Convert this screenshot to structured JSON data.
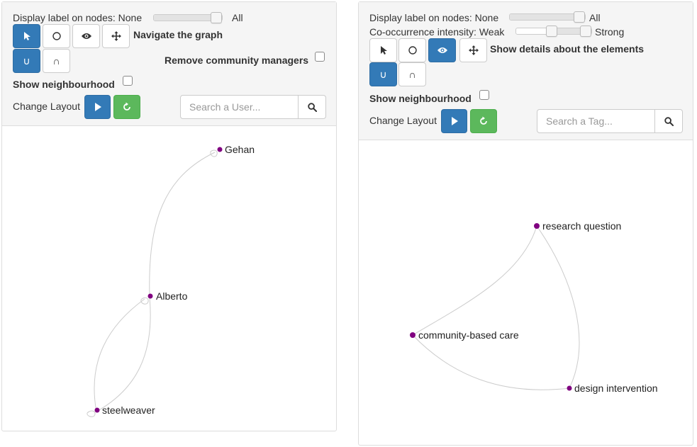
{
  "left_panel": {
    "label_slider": {
      "label": "Display label on nodes: None",
      "end_label": "All",
      "value": 1.0
    },
    "mode_description": "Navigate the graph",
    "remove_community_managers_label": "Remove community managers",
    "show_neighbourhood_label": "Show neighbourhood",
    "change_layout_label": "Change Layout",
    "search": {
      "placeholder": "Search a User..."
    },
    "tools": {
      "active_mode": "select",
      "active_set": "union",
      "union_symbol": "∪",
      "intersection_symbol": "∩"
    },
    "graph": {
      "nodes": [
        {
          "id": "gehan",
          "label": "Gehan"
        },
        {
          "id": "alberto",
          "label": "Alberto"
        },
        {
          "id": "steelweaver",
          "label": "steelweaver"
        }
      ],
      "edges": [
        {
          "from": "alberto",
          "to": "gehan",
          "directed": true
        },
        {
          "from": "alberto",
          "to": "steelweaver",
          "directed": true
        },
        {
          "from": "steelweaver",
          "to": "alberto",
          "directed": true
        }
      ],
      "node_color": "#800080",
      "edge_color": "#cccccc"
    }
  },
  "right_panel": {
    "label_slider": {
      "label": "Display label on nodes: None",
      "end_label": "All",
      "value": 1.0
    },
    "cooccurrence_slider": {
      "label": "Co-occurrence intensity: Weak",
      "end_label": "Strong",
      "value_low": 0.4,
      "value_high": 1.0
    },
    "mode_description": "Show details about the elements",
    "show_neighbourhood_label": "Show neighbourhood",
    "change_layout_label": "Change Layout",
    "search": {
      "placeholder": "Search a Tag..."
    },
    "tools": {
      "active_mode": "details",
      "active_set": "union",
      "union_symbol": "∪",
      "intersection_symbol": "∩"
    },
    "graph": {
      "nodes": [
        {
          "id": "rq",
          "label": "research question"
        },
        {
          "id": "cbc",
          "label": "community-based care"
        },
        {
          "id": "di",
          "label": "design intervention"
        }
      ],
      "edges": [
        {
          "from": "rq",
          "to": "cbc",
          "directed": false
        },
        {
          "from": "cbc",
          "to": "di",
          "directed": false
        },
        {
          "from": "rq",
          "to": "di",
          "directed": false
        }
      ],
      "node_color": "#800080",
      "edge_color": "#cccccc"
    }
  },
  "colors": {
    "primary": "#337ab7",
    "success": "#5cb85c",
    "controls_bg": "#f5f5f5",
    "node": "#800080"
  },
  "icons": {
    "select": "pointer-icon",
    "lasso": "circle-icon",
    "details": "eye-icon",
    "move": "move-arrows-icon",
    "run": "play-icon",
    "reset": "refresh-icon",
    "search": "magnifier-icon"
  }
}
